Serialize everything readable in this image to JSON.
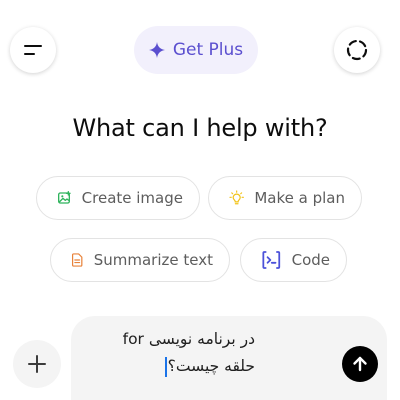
{
  "header": {
    "get_plus_label": "Get Plus",
    "icons": {
      "menu": "menu-icon",
      "upgrade": "sparkle-icon",
      "temporary_chat": "dashed-circle-icon"
    }
  },
  "main": {
    "headline": "What can I help with?"
  },
  "suggestions": [
    {
      "label": "Create image",
      "icon": "image-icon",
      "color": "#2fb35c"
    },
    {
      "label": "Make a plan",
      "icon": "lightbulb-icon",
      "color": "#f2c318"
    },
    {
      "label": "Summarize text",
      "icon": "document-icon",
      "color": "#e8823a"
    },
    {
      "label": "Code",
      "icon": "terminal-icon",
      "color": "#4b51d9"
    }
  ],
  "composer": {
    "text": "در برنامه نویسی for حلقه چیست؟",
    "add_icon": "plus-icon",
    "send_icon": "arrow-up-icon"
  },
  "colors": {
    "accent": "#5b4fcf",
    "get_plus_bg": "#f2f0fc",
    "composer_bg": "#f4f4f4",
    "send_bg": "#000000"
  }
}
